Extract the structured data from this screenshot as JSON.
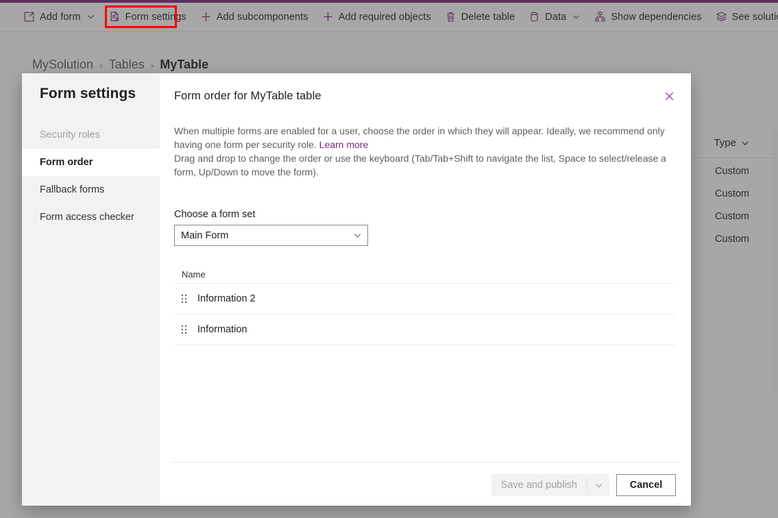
{
  "theme": {
    "accent": "#742774",
    "annotation": "#ff0000",
    "nav_selected_bg": "#ffffff",
    "nav_bg": "#f3f2f1",
    "link": "#742774"
  },
  "command_bar": {
    "items": [
      {
        "label": "Add form",
        "icon": "add-form-icon",
        "has_chevron": true
      },
      {
        "label": "Form settings",
        "icon": "form-settings-icon",
        "has_chevron": false,
        "highlighted": true
      },
      {
        "label": "Add subcomponents",
        "icon": "plus-icon",
        "has_chevron": false
      },
      {
        "label": "Add required objects",
        "icon": "plus-icon",
        "has_chevron": false
      },
      {
        "label": "Delete table",
        "icon": "trash-icon",
        "has_chevron": false
      },
      {
        "label": "Data",
        "icon": "database-icon",
        "has_chevron": true
      },
      {
        "label": "Show dependencies",
        "icon": "dependencies-icon",
        "has_chevron": false
      },
      {
        "label": "See solution layers",
        "icon": "layers-icon",
        "has_chevron": false
      }
    ]
  },
  "breadcrumb": {
    "solution": "MySolution",
    "section": "Tables",
    "current": "MyTable",
    "separator": "›"
  },
  "background_table": {
    "column_header": "Type",
    "rows": [
      "Custom",
      "Custom",
      "Custom",
      "Custom"
    ]
  },
  "dialog": {
    "nav_title": "Form settings",
    "nav_items": [
      {
        "label": "Security roles",
        "state": "disabled"
      },
      {
        "label": "Form order",
        "state": "selected"
      },
      {
        "label": "Fallback forms",
        "state": "normal"
      },
      {
        "label": "Form access checker",
        "state": "normal"
      }
    ],
    "title": "Form order for MyTable table",
    "close_icon": "close-icon",
    "description_line1": "When multiple forms are enabled for a user, choose the order in which they will appear. Ideally, we recommend only having one form per security role.",
    "description_link": "Learn more",
    "description_line2": "Drag and drop to change the order or use the keyboard (Tab/Tab+Shift to navigate the list, Space to select/release a form, Up/Down to move the form).",
    "form_set_label": "Choose a form set",
    "form_set_value": "Main Form",
    "form_set_options": [
      "Main Form"
    ],
    "list_column_header": "Name",
    "list_rows": [
      {
        "name": "Information 2",
        "handle_icon": "drag-handle-icon"
      },
      {
        "name": "Information",
        "handle_icon": "drag-handle-icon"
      }
    ],
    "footer": {
      "primary_label": "Save and publish",
      "primary_disabled": true,
      "primary_chevron_icon": "chevron-down-icon",
      "secondary_label": "Cancel"
    }
  }
}
